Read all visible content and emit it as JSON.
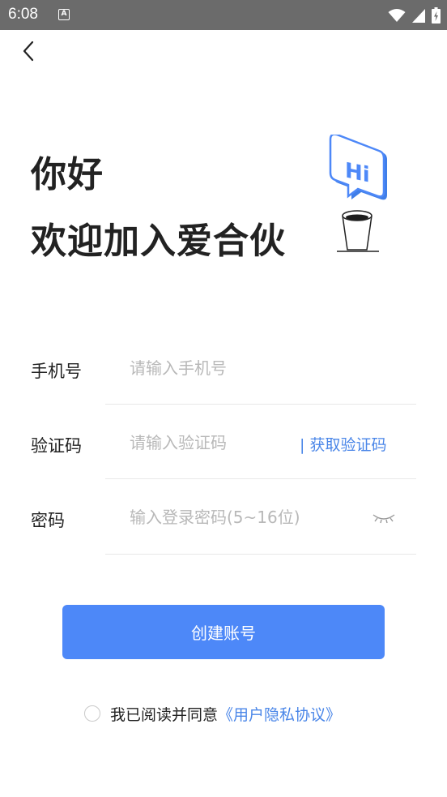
{
  "status_bar": {
    "time": "6:08",
    "notification_icon": "a-notification-icon",
    "icons": [
      "wifi-icon",
      "signal-icon",
      "battery-charging-icon"
    ]
  },
  "header": {
    "back_icon": "chevron-left-icon"
  },
  "hero": {
    "greeting": "你好",
    "welcome": "欢迎加入爱合伙",
    "bubble_text": "Hi"
  },
  "form": {
    "phone": {
      "label": "手机号",
      "placeholder": "请输入手机号",
      "value": ""
    },
    "code": {
      "label": "验证码",
      "placeholder": "请输入验证码",
      "value": "",
      "get_code_label": "| 获取验证码"
    },
    "password": {
      "label": "密码",
      "placeholder": "输入登录密码(5~16位)",
      "value": "",
      "eye_icon": "eye-closed-icon"
    }
  },
  "actions": {
    "create_label": "创建账号"
  },
  "agreement": {
    "text": "我已阅读并同意",
    "link": "《用户隐私协议》",
    "checked": false
  },
  "colors": {
    "accent": "#4d88f8",
    "link": "#4a86e8",
    "status_bar": "#6b6b6b",
    "divider": "#e8e8e8",
    "placeholder": "#b8b8b8"
  }
}
